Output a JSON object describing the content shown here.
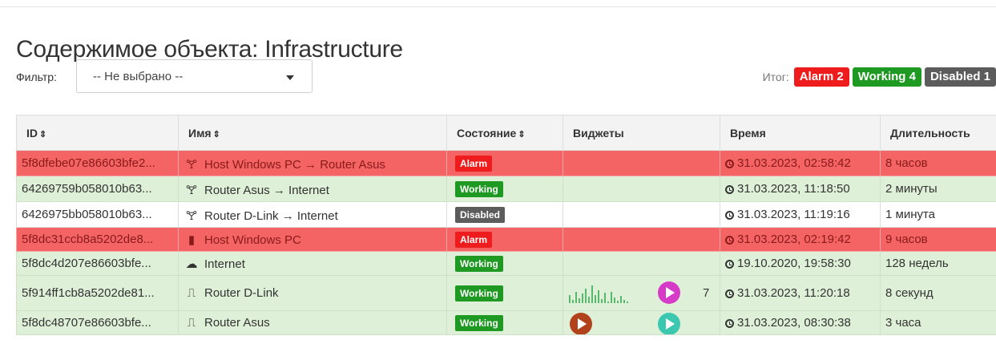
{
  "page": {
    "title": "Содержимое объекта: Infrastructure"
  },
  "filter": {
    "label": "Фильтр:",
    "selected": "-- Не выбрано --"
  },
  "summary": {
    "label": "Итог:",
    "badges": [
      {
        "text": "Alarm 2",
        "color": "#ee1c1c"
      },
      {
        "text": "Working 4",
        "color": "#1e9a22"
      },
      {
        "text": "Disabled 1",
        "color": "#5c5c5c"
      }
    ]
  },
  "table": {
    "columns": [
      {
        "label": "ID",
        "sort": "⇕"
      },
      {
        "label": "Имя",
        "sort": "⇕"
      },
      {
        "label": "Состояние",
        "sort": "⇕"
      },
      {
        "label": "Виджеты",
        "sort": ""
      },
      {
        "label": "Время",
        "sort": ""
      },
      {
        "label": "Длительность",
        "sort": ""
      }
    ],
    "rows": [
      {
        "id": "5f8dfebe07e86603bfe2...",
        "icon": "link-icon",
        "name": "Host Windows PC → Router Asus",
        "status": "Alarm",
        "time": "31.03.2023, 02:58:42",
        "duration": "8 часов"
      },
      {
        "id": "64269759b058010b63...",
        "icon": "link-icon",
        "name": "Router Asus → Internet",
        "status": "Working",
        "time": "31.03.2023, 11:18:50",
        "duration": "2 минуты"
      },
      {
        "id": "6426975bb058010b63...",
        "icon": "link-icon",
        "name": "Router D-Link → Internet",
        "status": "Disabled",
        "time": "31.03.2023, 11:19:16",
        "duration": "1 минута"
      },
      {
        "id": "5f8dc31ccb8a5202de8...",
        "icon": "computer-icon",
        "name": "Host Windows PC",
        "status": "Alarm",
        "time": "31.03.2023, 02:19:42",
        "duration": "9 часов"
      },
      {
        "id": "5f8dc4d207e86603bfe...",
        "icon": "cloud-icon",
        "name": "Internet",
        "status": "Working",
        "time": "19.10.2020, 19:58:30",
        "duration": "128 недель"
      },
      {
        "id": "5f914ff1cb8a5202de81...",
        "icon": "router-icon",
        "name": "Router D-Link",
        "status": "Working",
        "time": "31.03.2023, 11:20:18",
        "duration": "8 секунд",
        "widget_count": "7"
      },
      {
        "id": "5f8dc48707e86603bfe...",
        "icon": "router-icon",
        "name": "Router Asus",
        "status": "Working",
        "time": "31.03.2023, 08:30:38",
        "duration": "3 часа"
      }
    ]
  },
  "colors": {
    "alarm": "#ee1c1c",
    "working": "#1e9a22",
    "disabled": "#5c5c5c",
    "play_magenta": "#d63bc8",
    "play_brown": "#b2421c",
    "play_teal": "#3cc8b0",
    "sparkline": "#2ea54a"
  }
}
